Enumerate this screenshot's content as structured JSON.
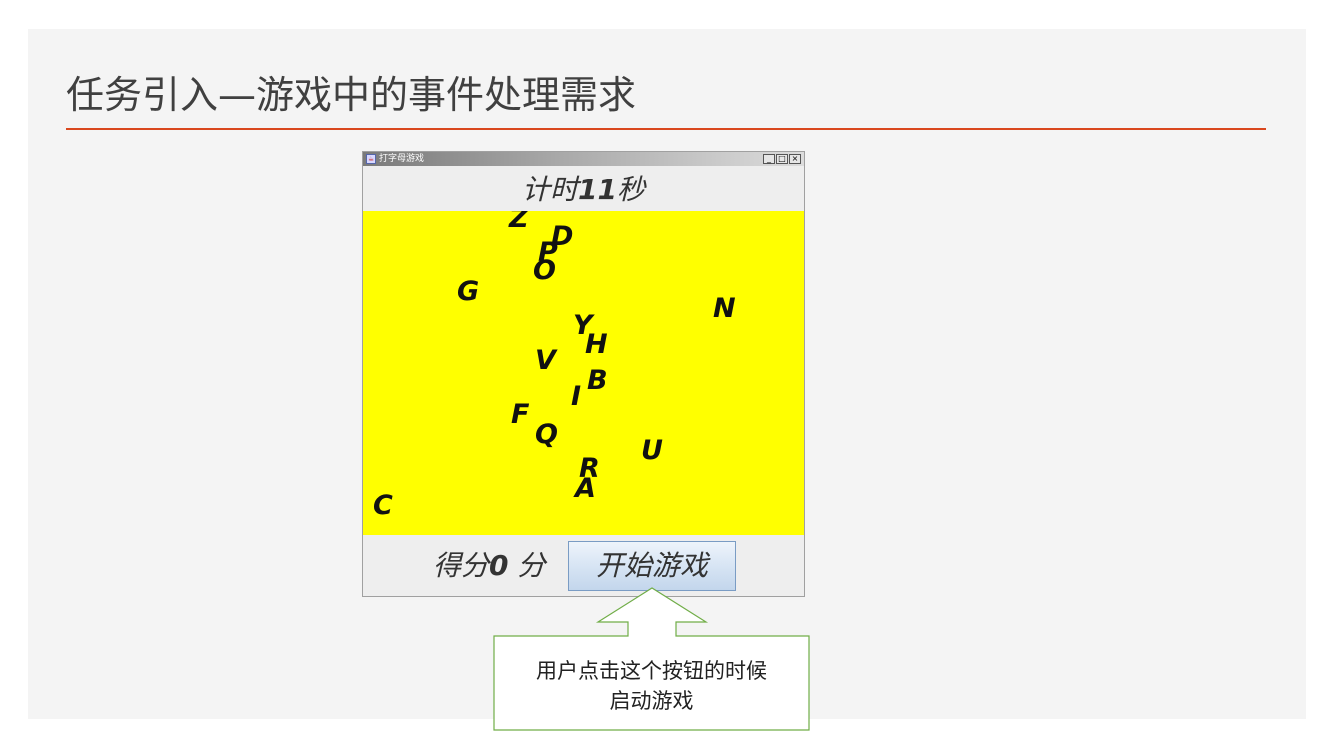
{
  "slide": {
    "title": "任务引入—游戏中的事件处理需求"
  },
  "window": {
    "title": "打字母游戏",
    "icon": "java-cup-icon",
    "controls": [
      "_",
      "□",
      "×"
    ]
  },
  "timer": {
    "prefix": "计时",
    "value": "11",
    "suffix": "秒"
  },
  "game": {
    "background_color": "#ffff00",
    "letters": [
      "Z",
      "D",
      "P",
      "O",
      "G",
      "N",
      "Y",
      "H",
      "V",
      "B",
      "I",
      "F",
      "Q",
      "U",
      "R",
      "A",
      "C"
    ]
  },
  "score": {
    "prefix": "得分",
    "value": "0",
    "suffix": " 分"
  },
  "start_button": {
    "label": "开始游戏"
  },
  "callout": {
    "line1": "用户点击这个按钮的时候",
    "line2": "启动游戏",
    "border_color": "#70ad47"
  }
}
